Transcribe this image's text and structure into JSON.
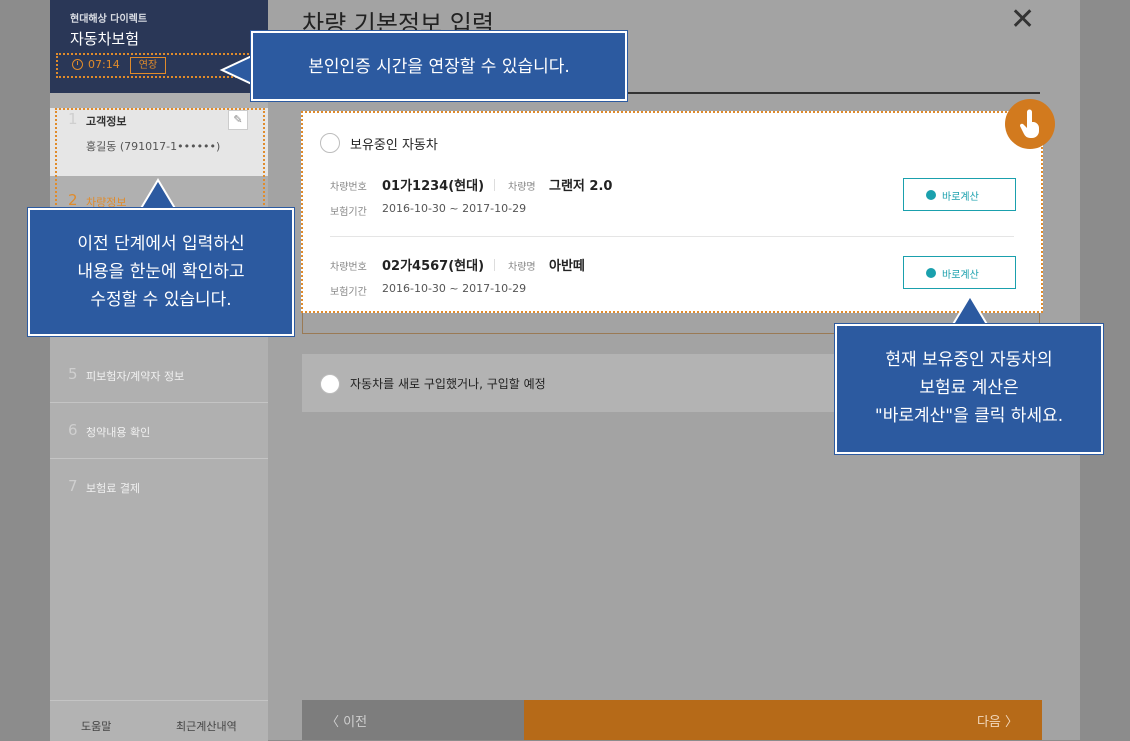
{
  "sidebar": {
    "company": "현대해상 다이렉트",
    "title": "자동차보험",
    "timer": "07:14",
    "extend_label": "연장",
    "steps": [
      {
        "num": "1",
        "label": "고객정보",
        "sub": "홍길동 (791017-1••••••)"
      },
      {
        "num": "2",
        "label": "차량정보"
      },
      {
        "num": "5",
        "label": "피보험자/계약자 정보"
      },
      {
        "num": "6",
        "label": "청약내용 확인"
      },
      {
        "num": "7",
        "label": "보험료 결제"
      }
    ],
    "footer": {
      "help": "도움말",
      "recent": "최근계산내역"
    }
  },
  "main": {
    "title": "차량 기본정보 입력",
    "close": "✕",
    "owned_option": "보유중인 자동차",
    "new_option": "자동차를 새로 구입했거나, 구입할 예정",
    "vehicles": [
      {
        "plate_key": "차량번호",
        "plate": "01가1234(현대)",
        "name_key": "차량명",
        "name": "그랜저 2.0",
        "period_key": "보험기간",
        "period": "2016-10-30 ~ 2017-10-29",
        "calc_label": "바로계산"
      },
      {
        "plate_key": "차량번호",
        "plate": "02가4567(현대)",
        "name_key": "차량명",
        "name": "아반떼",
        "period_key": "보험기간",
        "period": "2016-10-30 ~ 2017-10-29",
        "calc_label": "바로계산"
      }
    ],
    "prev_label": "〈 이전",
    "next_label": "다음 〉"
  },
  "callouts": {
    "timer": "본인인증 시간을 연장할 수 있습니다.",
    "edit": [
      "이전 단계에서 입력하신",
      "내용을 한눈에 확인하고",
      "수정할 수 있습니다."
    ],
    "calc": [
      "현재 보유중인 자동차의",
      "보험료 계산은",
      "\"바로계산\"을 클릭 하세요."
    ]
  },
  "colors": {
    "accent": "#e08b2b",
    "callout": "#2c5aa0",
    "teal": "#1aa0ad",
    "navy": "#2a3757"
  }
}
